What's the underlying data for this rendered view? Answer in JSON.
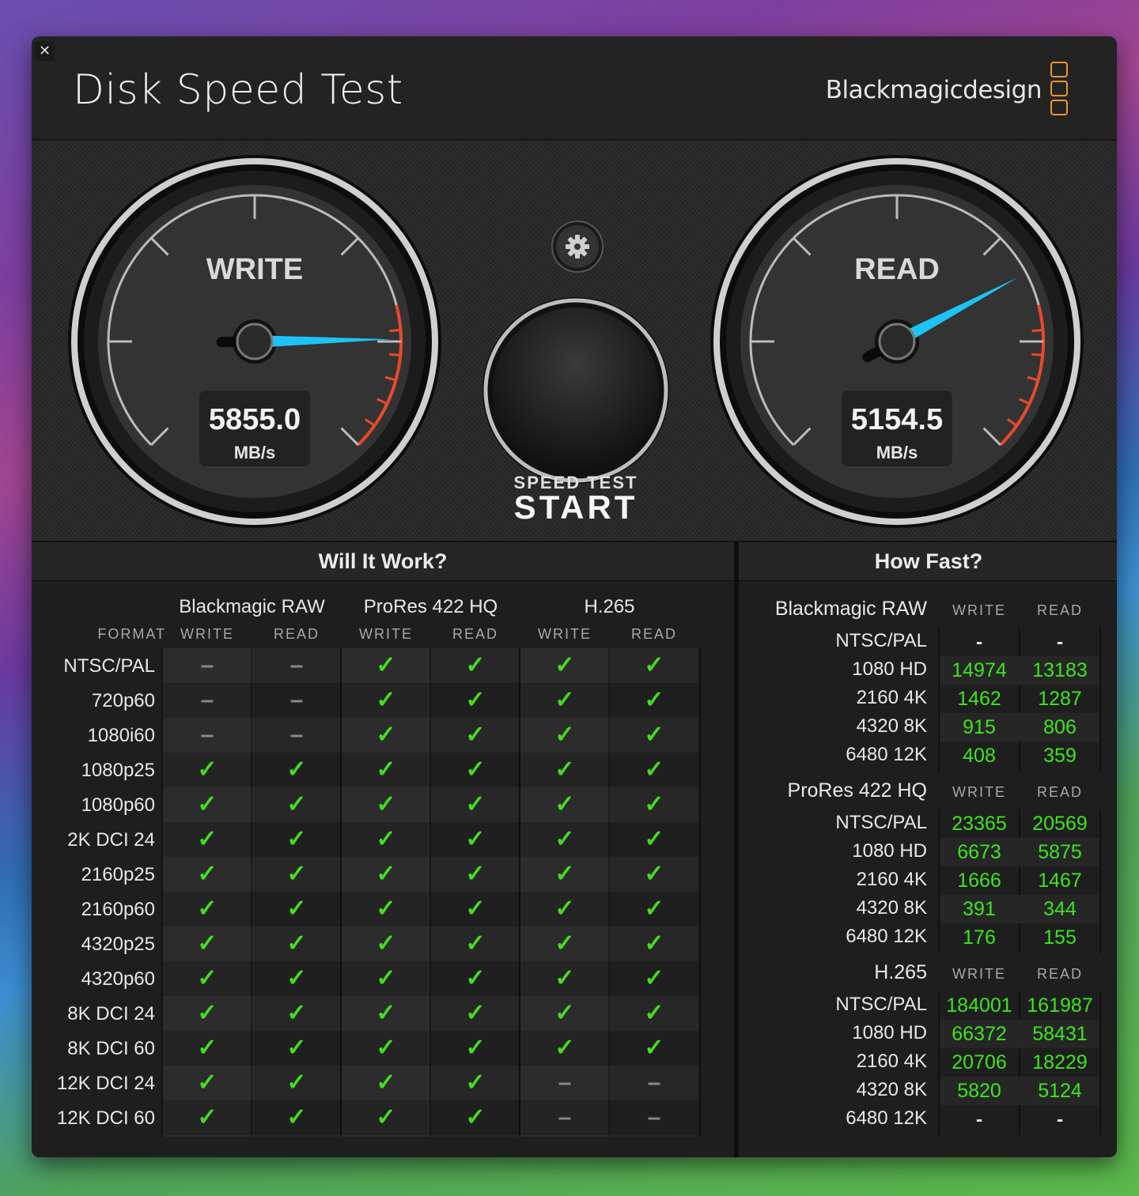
{
  "window": {
    "close_label": "✕",
    "title": "Disk Speed Test",
    "brand": "Blackmagicdesign"
  },
  "gauges": {
    "write": {
      "label": "WRITE",
      "value": "5855.0",
      "unit": "MB/s",
      "needle_fraction": 0.83
    },
    "read": {
      "label": "READ",
      "value": "5154.5",
      "unit": "MB/s",
      "needle_fraction": 0.73
    }
  },
  "start_button": {
    "top_label": "SPEED TEST",
    "main_label": "START"
  },
  "settings_icon": "gear-icon",
  "colors": {
    "needle": "#1ec3f5",
    "redline": "#e84a2c",
    "check": "#44dd22",
    "fast_value": "#3ee51d",
    "brand_logo": "#e8962e"
  },
  "will_it_work": {
    "title": "Will It Work?",
    "format_header": "FORMAT",
    "groups": [
      "Blackmagic RAW",
      "ProRes 422 HQ",
      "H.265"
    ],
    "subheaders": [
      "WRITE",
      "READ",
      "WRITE",
      "READ",
      "WRITE",
      "READ"
    ],
    "rows": [
      {
        "format": "NTSC/PAL",
        "cells": [
          "–",
          "–",
          "✓",
          "✓",
          "✓",
          "✓"
        ]
      },
      {
        "format": "720p60",
        "cells": [
          "–",
          "–",
          "✓",
          "✓",
          "✓",
          "✓"
        ]
      },
      {
        "format": "1080i60",
        "cells": [
          "–",
          "–",
          "✓",
          "✓",
          "✓",
          "✓"
        ]
      },
      {
        "format": "1080p25",
        "cells": [
          "✓",
          "✓",
          "✓",
          "✓",
          "✓",
          "✓"
        ]
      },
      {
        "format": "1080p60",
        "cells": [
          "✓",
          "✓",
          "✓",
          "✓",
          "✓",
          "✓"
        ]
      },
      {
        "format": "2K DCI 24",
        "cells": [
          "✓",
          "✓",
          "✓",
          "✓",
          "✓",
          "✓"
        ]
      },
      {
        "format": "2160p25",
        "cells": [
          "✓",
          "✓",
          "✓",
          "✓",
          "✓",
          "✓"
        ]
      },
      {
        "format": "2160p60",
        "cells": [
          "✓",
          "✓",
          "✓",
          "✓",
          "✓",
          "✓"
        ]
      },
      {
        "format": "4320p25",
        "cells": [
          "✓",
          "✓",
          "✓",
          "✓",
          "✓",
          "✓"
        ]
      },
      {
        "format": "4320p60",
        "cells": [
          "✓",
          "✓",
          "✓",
          "✓",
          "✓",
          "✓"
        ]
      },
      {
        "format": "8K DCI 24",
        "cells": [
          "✓",
          "✓",
          "✓",
          "✓",
          "✓",
          "✓"
        ]
      },
      {
        "format": "8K DCI 60",
        "cells": [
          "✓",
          "✓",
          "✓",
          "✓",
          "✓",
          "✓"
        ]
      },
      {
        "format": "12K DCI 24",
        "cells": [
          "✓",
          "✓",
          "✓",
          "✓",
          "–",
          "–"
        ]
      },
      {
        "format": "12K DCI 60",
        "cells": [
          "✓",
          "✓",
          "✓",
          "✓",
          "–",
          "–"
        ]
      }
    ]
  },
  "how_fast": {
    "title": "How Fast?",
    "groups": [
      {
        "name": "Blackmagic RAW",
        "write_label": "WRITE",
        "read_label": "READ",
        "rows": [
          {
            "format": "NTSC/PAL",
            "write": "-",
            "read": "-"
          },
          {
            "format": "1080 HD",
            "write": "14974",
            "read": "13183"
          },
          {
            "format": "2160 4K",
            "write": "1462",
            "read": "1287"
          },
          {
            "format": "4320 8K",
            "write": "915",
            "read": "806"
          },
          {
            "format": "6480 12K",
            "write": "408",
            "read": "359"
          }
        ]
      },
      {
        "name": "ProRes 422 HQ",
        "write_label": "WRITE",
        "read_label": "READ",
        "rows": [
          {
            "format": "NTSC/PAL",
            "write": "23365",
            "read": "20569"
          },
          {
            "format": "1080 HD",
            "write": "6673",
            "read": "5875"
          },
          {
            "format": "2160 4K",
            "write": "1666",
            "read": "1467"
          },
          {
            "format": "4320 8K",
            "write": "391",
            "read": "344"
          },
          {
            "format": "6480 12K",
            "write": "176",
            "read": "155"
          }
        ]
      },
      {
        "name": "H.265",
        "write_label": "WRITE",
        "read_label": "READ",
        "rows": [
          {
            "format": "NTSC/PAL",
            "write": "184001",
            "read": "161987"
          },
          {
            "format": "1080 HD",
            "write": "66372",
            "read": "58431"
          },
          {
            "format": "2160 4K",
            "write": "20706",
            "read": "18229"
          },
          {
            "format": "4320 8K",
            "write": "5820",
            "read": "5124"
          },
          {
            "format": "6480 12K",
            "write": "-",
            "read": "-"
          }
        ]
      }
    ]
  }
}
